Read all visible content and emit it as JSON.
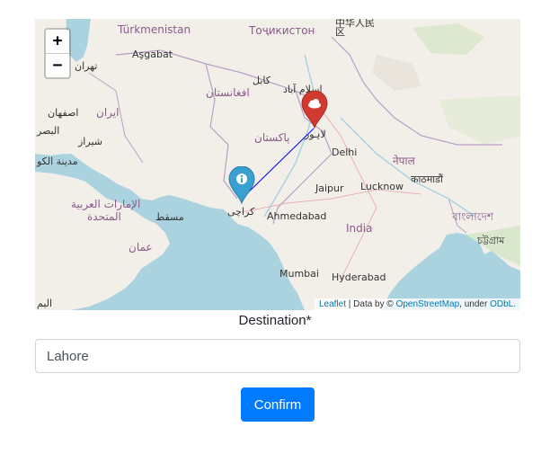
{
  "map": {
    "zoom_in_label": "+",
    "zoom_out_label": "−",
    "attribution": {
      "leaflet": "Leaflet",
      "data_by": "| Data by ©",
      "osm": "OpenStreetMap",
      "under": ", under",
      "odbl": "ODbL."
    },
    "labels": {
      "turkmenistan": "Türkmenistan",
      "tajikistan": "Тоҷикистон",
      "asgabat": "Aşgabat",
      "tehran": "تهران",
      "kabul": "کابل",
      "islamabad": "اسلام آباد",
      "afghanistan": "افغانستان",
      "isfahan": "اصفهان",
      "iran": "ایران",
      "basra": "البصر",
      "shiraz": "شیراز",
      "kuwait": "مدينة الكو",
      "pakistan": "پاکستان",
      "lahore": "لاہور",
      "delhi": "Delhi",
      "nepal": "नेपाल",
      "kathmandu": "काठमाडौं",
      "uae": "الإمارات العربية",
      "uae2": "المتحدة",
      "muscat": "مسقط",
      "karachi": "کراچی",
      "jaipur": "Jaipur",
      "lucknow": "Lucknow",
      "ahmedabad": "Ahmedabad",
      "india": "India",
      "bangladesh": "বাংলাদেশ",
      "chittagong": "চট্টগ্রাম",
      "oman": "عمان",
      "mumbai": "Mumbai",
      "hyderabad": "Hyderabad",
      "china_top": "中华人民",
      "china_char": "区",
      "yemen_edge": "اليم"
    }
  },
  "form": {
    "destination_label": "Destination*",
    "destination_value": "Lahore",
    "confirm_label": "Confirm"
  },
  "colors": {
    "origin_marker": "#3a9fd1",
    "destination_marker": "#d13a2f",
    "route_line": "#0000ff",
    "confirm_button": "#007bff"
  },
  "markers": {
    "origin_icon": "info-icon",
    "destination_icon": "cloud-icon"
  }
}
